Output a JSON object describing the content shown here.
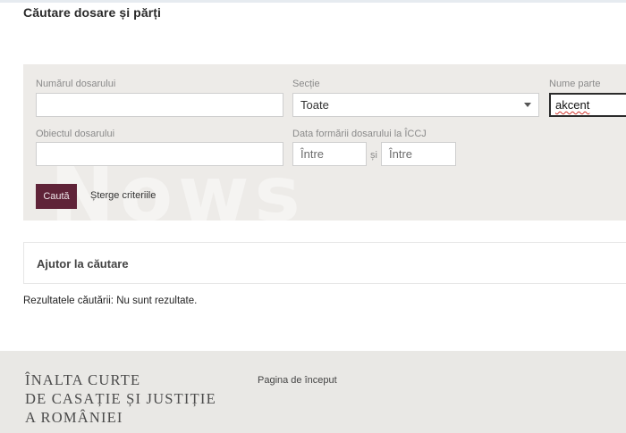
{
  "page": {
    "title": "Căutare dosare și părți"
  },
  "watermark": "Nows",
  "search_form": {
    "case_number": {
      "label": "Numărul dosarului",
      "value": ""
    },
    "section": {
      "label": "Secție",
      "selected": "Toate"
    },
    "party_name": {
      "label": "Nume parte",
      "value": "akcent"
    },
    "case_object": {
      "label": "Obiectul dosarului",
      "value": ""
    },
    "date_formed": {
      "label": "Data formării dosarului la ÎCCJ",
      "from_placeholder": "Între",
      "separator": "și",
      "to_placeholder": "Între"
    },
    "search_button": "Caută",
    "clear_link": "Șterge criteriile"
  },
  "help": {
    "title": "Ajutor la căutare"
  },
  "results": {
    "text": "Rezultatele căutării: Nu sunt rezultate."
  },
  "footer": {
    "logo_lines": [
      "ÎNALTA CURTE",
      "DE CASAȚIE ȘI JUSTIȚIE",
      "A ROMÂNIEI"
    ],
    "home_link": "Pagina de început"
  },
  "colors": {
    "primary_button": "#5f2338",
    "panel_background": "#edebe8",
    "footer_background": "#e9e8e5"
  }
}
